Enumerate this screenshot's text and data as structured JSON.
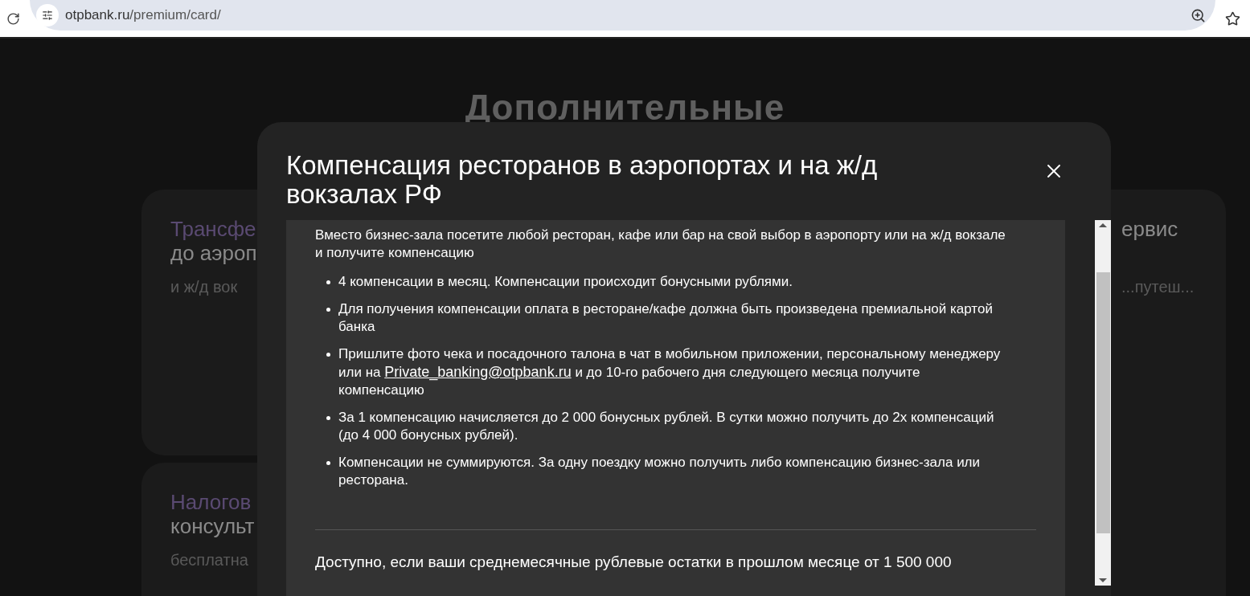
{
  "browser": {
    "url_host": "otpbank.ru",
    "url_path": "/premium/card/"
  },
  "page": {
    "heading": "Дополнительные",
    "left_cards": [
      {
        "title_accent": "Трансфе",
        "title": "до аэроп",
        "subtitle": "и ж/д вок"
      },
      {
        "title_accent": "Налогов",
        "title": "консульт",
        "subtitle": "бесплатна"
      }
    ],
    "right_card": {
      "title": "ервис",
      "subtitle": "...путеш..."
    }
  },
  "modal": {
    "title": "Компенсация ресторанов в аэропортах и на ж/д вокзалах РФ",
    "intro": "Вместо бизнес-зала посетите любой ресторан, кафе или бар на свой выбор в аэропорту или на ж/д вокзале и получите компенсацию",
    "bullets": [
      {
        "text": "4 компенсации в месяц. Компенсации происходит бонусными рублями."
      },
      {
        "text": "Для получения компенсации оплата в ресторане/кафе должна быть произведена премиальной картой банка"
      },
      {
        "text": "Пришлите фото чека и посадочного талона в чат в мобильном приложении, персональному менеджеру или на",
        "link": "Private_banking@otpbank.ru",
        "after": "и до 10-го рабочего дня следующего месяца получите компенсацию"
      },
      {
        "text": "За 1 компенсацию начисляется до 2 000 бонусных рублей. В сутки можно получить до 2х компенсаций (до 4 000 бонусных рублей)."
      },
      {
        "text": "Компенсации не суммируются. За одну поездку можно получить либо компенсацию бизнес-зала или ресторана."
      }
    ],
    "footer": "Доступно, если ваши среднемесячные рублевые остатки в прошлом месяце от 1 500 000"
  }
}
